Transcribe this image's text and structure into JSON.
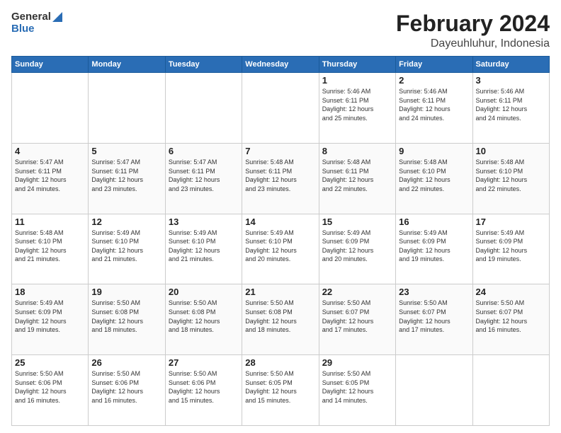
{
  "header": {
    "logo_general": "General",
    "logo_blue": "Blue",
    "title": "February 2024",
    "subtitle": "Dayeuhluhur, Indonesia"
  },
  "calendar": {
    "days_of_week": [
      "Sunday",
      "Monday",
      "Tuesday",
      "Wednesday",
      "Thursday",
      "Friday",
      "Saturday"
    ],
    "weeks": [
      [
        {
          "day": "",
          "info": ""
        },
        {
          "day": "",
          "info": ""
        },
        {
          "day": "",
          "info": ""
        },
        {
          "day": "",
          "info": ""
        },
        {
          "day": "1",
          "info": "Sunrise: 5:46 AM\nSunset: 6:11 PM\nDaylight: 12 hours\nand 25 minutes."
        },
        {
          "day": "2",
          "info": "Sunrise: 5:46 AM\nSunset: 6:11 PM\nDaylight: 12 hours\nand 24 minutes."
        },
        {
          "day": "3",
          "info": "Sunrise: 5:46 AM\nSunset: 6:11 PM\nDaylight: 12 hours\nand 24 minutes."
        }
      ],
      [
        {
          "day": "4",
          "info": "Sunrise: 5:47 AM\nSunset: 6:11 PM\nDaylight: 12 hours\nand 24 minutes."
        },
        {
          "day": "5",
          "info": "Sunrise: 5:47 AM\nSunset: 6:11 PM\nDaylight: 12 hours\nand 23 minutes."
        },
        {
          "day": "6",
          "info": "Sunrise: 5:47 AM\nSunset: 6:11 PM\nDaylight: 12 hours\nand 23 minutes."
        },
        {
          "day": "7",
          "info": "Sunrise: 5:48 AM\nSunset: 6:11 PM\nDaylight: 12 hours\nand 23 minutes."
        },
        {
          "day": "8",
          "info": "Sunrise: 5:48 AM\nSunset: 6:11 PM\nDaylight: 12 hours\nand 22 minutes."
        },
        {
          "day": "9",
          "info": "Sunrise: 5:48 AM\nSunset: 6:10 PM\nDaylight: 12 hours\nand 22 minutes."
        },
        {
          "day": "10",
          "info": "Sunrise: 5:48 AM\nSunset: 6:10 PM\nDaylight: 12 hours\nand 22 minutes."
        }
      ],
      [
        {
          "day": "11",
          "info": "Sunrise: 5:48 AM\nSunset: 6:10 PM\nDaylight: 12 hours\nand 21 minutes."
        },
        {
          "day": "12",
          "info": "Sunrise: 5:49 AM\nSunset: 6:10 PM\nDaylight: 12 hours\nand 21 minutes."
        },
        {
          "day": "13",
          "info": "Sunrise: 5:49 AM\nSunset: 6:10 PM\nDaylight: 12 hours\nand 21 minutes."
        },
        {
          "day": "14",
          "info": "Sunrise: 5:49 AM\nSunset: 6:10 PM\nDaylight: 12 hours\nand 20 minutes."
        },
        {
          "day": "15",
          "info": "Sunrise: 5:49 AM\nSunset: 6:09 PM\nDaylight: 12 hours\nand 20 minutes."
        },
        {
          "day": "16",
          "info": "Sunrise: 5:49 AM\nSunset: 6:09 PM\nDaylight: 12 hours\nand 19 minutes."
        },
        {
          "day": "17",
          "info": "Sunrise: 5:49 AM\nSunset: 6:09 PM\nDaylight: 12 hours\nand 19 minutes."
        }
      ],
      [
        {
          "day": "18",
          "info": "Sunrise: 5:49 AM\nSunset: 6:09 PM\nDaylight: 12 hours\nand 19 minutes."
        },
        {
          "day": "19",
          "info": "Sunrise: 5:50 AM\nSunset: 6:08 PM\nDaylight: 12 hours\nand 18 minutes."
        },
        {
          "day": "20",
          "info": "Sunrise: 5:50 AM\nSunset: 6:08 PM\nDaylight: 12 hours\nand 18 minutes."
        },
        {
          "day": "21",
          "info": "Sunrise: 5:50 AM\nSunset: 6:08 PM\nDaylight: 12 hours\nand 18 minutes."
        },
        {
          "day": "22",
          "info": "Sunrise: 5:50 AM\nSunset: 6:07 PM\nDaylight: 12 hours\nand 17 minutes."
        },
        {
          "day": "23",
          "info": "Sunrise: 5:50 AM\nSunset: 6:07 PM\nDaylight: 12 hours\nand 17 minutes."
        },
        {
          "day": "24",
          "info": "Sunrise: 5:50 AM\nSunset: 6:07 PM\nDaylight: 12 hours\nand 16 minutes."
        }
      ],
      [
        {
          "day": "25",
          "info": "Sunrise: 5:50 AM\nSunset: 6:06 PM\nDaylight: 12 hours\nand 16 minutes."
        },
        {
          "day": "26",
          "info": "Sunrise: 5:50 AM\nSunset: 6:06 PM\nDaylight: 12 hours\nand 16 minutes."
        },
        {
          "day": "27",
          "info": "Sunrise: 5:50 AM\nSunset: 6:06 PM\nDaylight: 12 hours\nand 15 minutes."
        },
        {
          "day": "28",
          "info": "Sunrise: 5:50 AM\nSunset: 6:05 PM\nDaylight: 12 hours\nand 15 minutes."
        },
        {
          "day": "29",
          "info": "Sunrise: 5:50 AM\nSunset: 6:05 PM\nDaylight: 12 hours\nand 14 minutes."
        },
        {
          "day": "",
          "info": ""
        },
        {
          "day": "",
          "info": ""
        }
      ]
    ]
  }
}
